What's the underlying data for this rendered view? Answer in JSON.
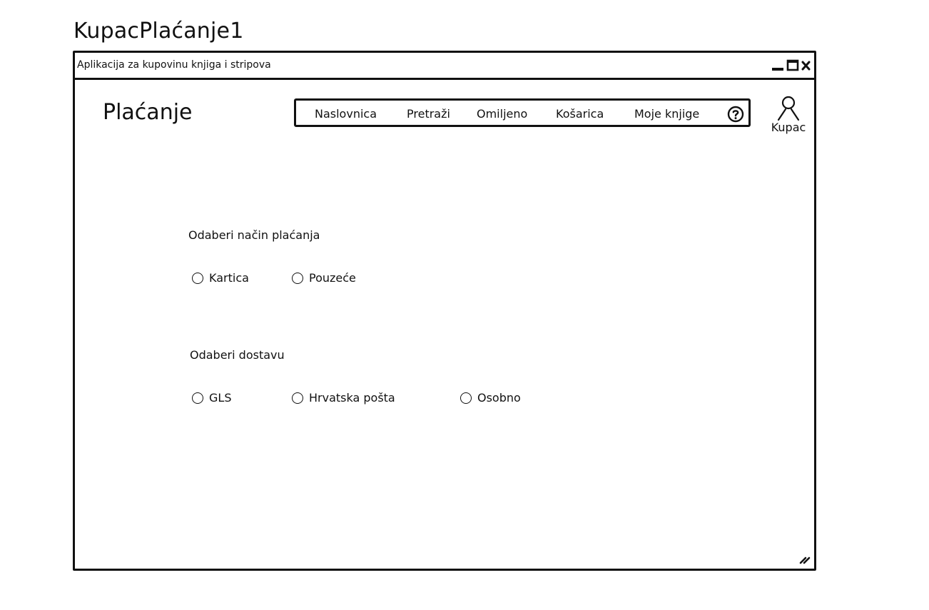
{
  "mockup": {
    "title": "KupacPlaćanje1"
  },
  "window": {
    "title": "Aplikacija za kupovinu knjiga i stripova",
    "controls": [
      "minimize-icon",
      "maximize-icon",
      "close-icon"
    ]
  },
  "header": {
    "page_title": "Plaćanje",
    "nav": {
      "items": [
        "Naslovnica",
        "Pretraži",
        "Omiljeno",
        "Košarica",
        "Moje knjige"
      ],
      "help_icon": "help-circle-icon"
    },
    "user": {
      "icon": "user-icon",
      "label": "Kupac"
    }
  },
  "payment": {
    "label": "Odaberi način plaćanja",
    "options": [
      "Kartica",
      "Pouzeće"
    ]
  },
  "delivery": {
    "label": "Odaberi dostavu",
    "options": [
      "GLS",
      "Hrvatska pošta",
      "Osobno"
    ]
  }
}
